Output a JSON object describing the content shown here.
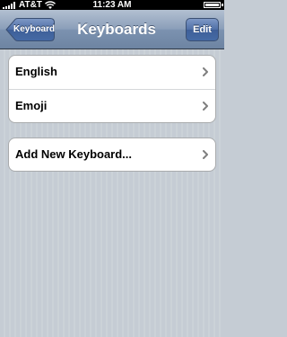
{
  "status_bar": {
    "carrier": "AT&T",
    "time": "11:23 AM",
    "signal_bars": 5,
    "battery_level": 1.0
  },
  "nav_bar": {
    "title": "Keyboards",
    "back_label": "Keyboard",
    "edit_label": "Edit"
  },
  "sections": [
    {
      "items": [
        {
          "label": "English",
          "icon": "chevron-right-icon"
        },
        {
          "label": "Emoji",
          "icon": "chevron-right-icon"
        }
      ]
    },
    {
      "items": [
        {
          "label": "Add New Keyboard...",
          "icon": "chevron-right-icon"
        }
      ]
    }
  ],
  "colors": {
    "background": "#c5ccd4",
    "nav_bar": "#6d84a2",
    "edit_button": "#456aa5"
  }
}
